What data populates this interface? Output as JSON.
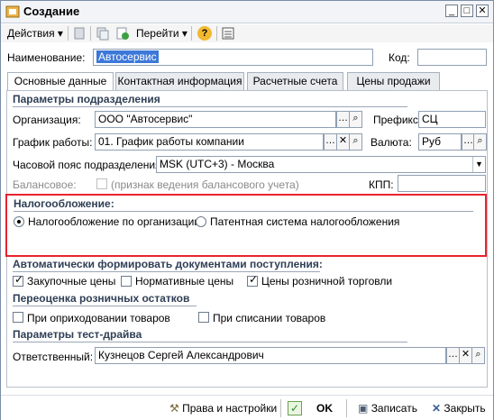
{
  "window": {
    "title": "Создание",
    "minimize": "_",
    "maximize": "□",
    "close": "✕"
  },
  "toolbar": {
    "actions_label": "Действия",
    "goto_label": "Перейти",
    "help_icon": "?"
  },
  "header": {
    "name_label": "Наименование:",
    "name_value": "Автосервис",
    "code_label": "Код:",
    "code_value": ""
  },
  "tabs": [
    {
      "label": "Основные данные",
      "active": true
    },
    {
      "label": "Контактная информация"
    },
    {
      "label": "Расчетные счета"
    },
    {
      "label": "Цены продажи"
    }
  ],
  "division": {
    "title": "Параметры подразделения",
    "org_label": "Организация:",
    "org_value": "ООО \"Автосервис\"",
    "prefix_label": "Префикс:",
    "prefix_value": "СЦ",
    "schedule_label": "График работы:",
    "schedule_value": "01. График работы компании",
    "currency_label": "Валюта:",
    "currency_value": "Руб",
    "tz_label": "Часовой пояс подразделения:",
    "tz_value": "MSK (UTC+3) - Москва",
    "balance_label": "Балансовое:",
    "balance_hint": "(признак ведения балансового учета)",
    "kpp_label": "КПП:",
    "kpp_value": ""
  },
  "taxation": {
    "title": "Налогообложение:",
    "option1": "Налогообложение по организации",
    "option2": "Патентная система налогообложения",
    "selected": "option1"
  },
  "auto_docs": {
    "title": "Автоматически формировать документами поступления:",
    "purchase_prices": "Закупочные цены",
    "purchase_checked": true,
    "normative_prices": "Нормативные цены",
    "normative_checked": false,
    "retail_prices": "Цены розничной торговли",
    "retail_checked": true
  },
  "revaluation": {
    "title": "Переоценка розничных остатков",
    "on_receipt": "При оприходовании товаров",
    "receipt_checked": false,
    "on_writeoff": "При списании товаров",
    "writeoff_checked": false
  },
  "testdrive": {
    "title": "Параметры тест-драйва",
    "responsible_label": "Ответственный:",
    "responsible_value": "Кузнецов Сергей Александрович"
  },
  "footer": {
    "rights_label": "Права и настройки",
    "ok_label": "OK",
    "save_label": "Записать",
    "close_label": "Закрыть"
  },
  "colors": {
    "highlight_border": "#e8232e",
    "section_text": "#2f3f55",
    "selection": "#3c78d8"
  }
}
